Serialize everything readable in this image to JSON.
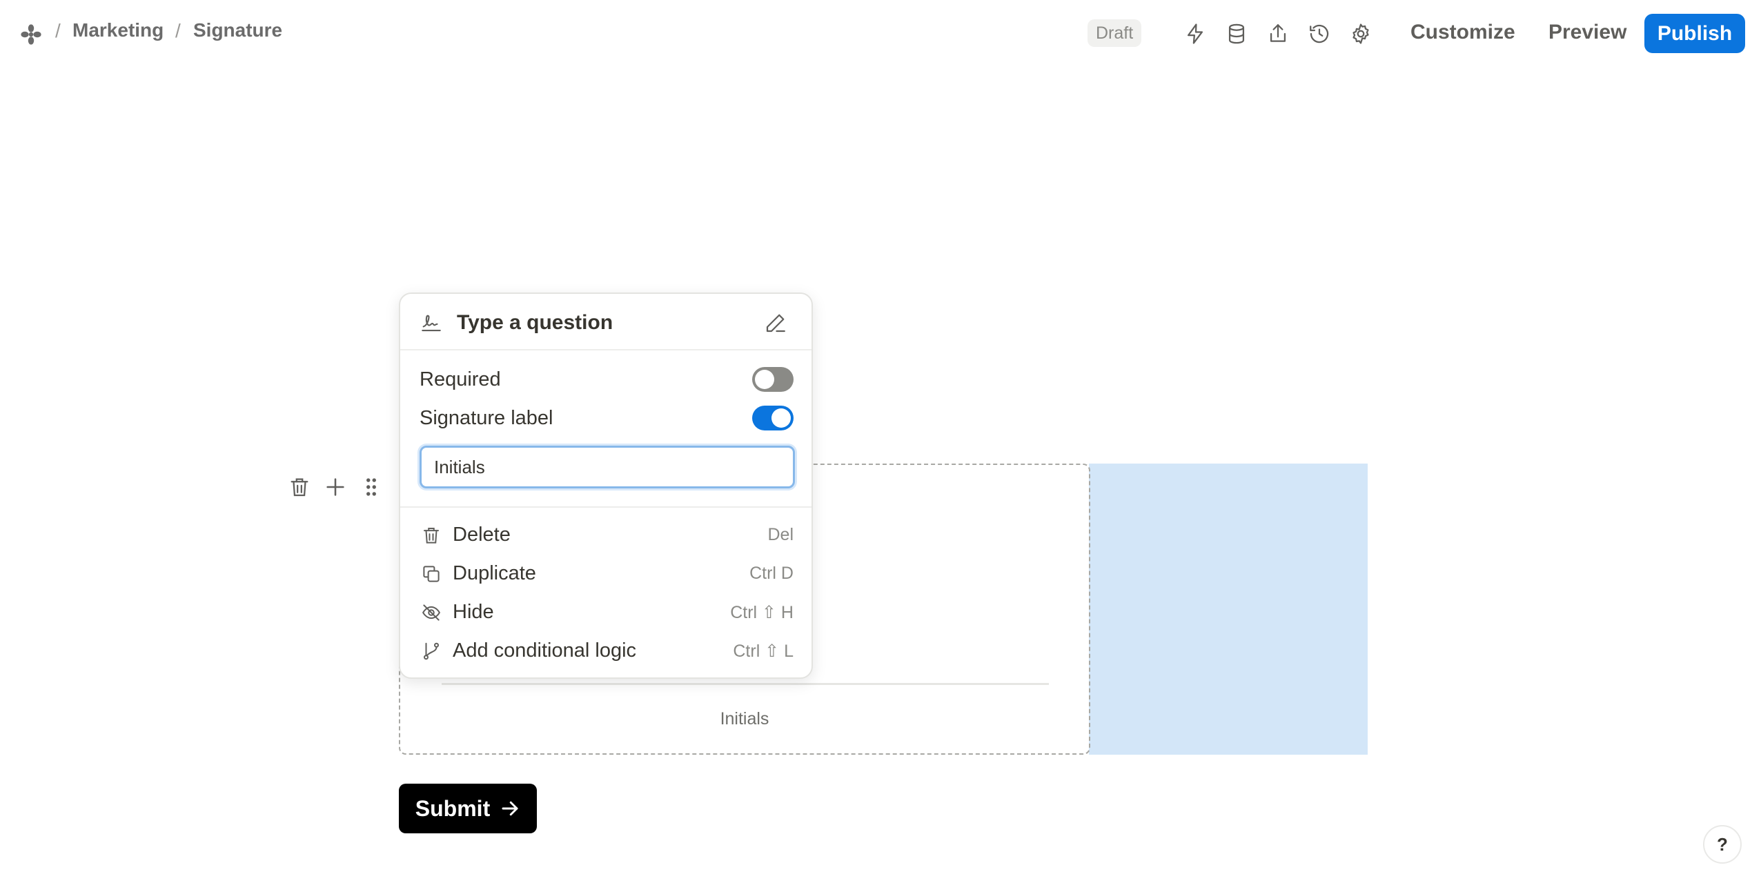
{
  "header": {
    "breadcrumb": [
      "Marketing",
      "Signature"
    ],
    "status_badge": "Draft",
    "icons": [
      "bolt-icon",
      "database-icon",
      "share-icon",
      "history-icon",
      "settings-icon"
    ],
    "customize_label": "Customize",
    "preview_label": "Preview",
    "publish_label": "Publish",
    "accent_color": "#0b75de"
  },
  "block": {
    "tools": [
      "trash-icon",
      "plus-icon",
      "drag-handle-icon"
    ],
    "signature_caption": "Initials",
    "highlight_color": "#d3e6f8"
  },
  "popup": {
    "question_placeholder": "Type a question",
    "required_label": "Required",
    "required_on": false,
    "signature_label_label": "Signature label",
    "signature_label_on": true,
    "signature_label_value": "Initials",
    "menu": [
      {
        "label": "Delete",
        "shortcut": "Del",
        "icon": "trash-icon"
      },
      {
        "label": "Duplicate",
        "shortcut": "Ctrl D",
        "icon": "duplicate-icon"
      },
      {
        "label": "Hide",
        "shortcut": "Ctrl ⇧ H",
        "icon": "eye-off-icon"
      },
      {
        "label": "Add conditional logic",
        "shortcut": "Ctrl ⇧ L",
        "icon": "branch-icon"
      }
    ]
  },
  "submit": {
    "label": "Submit"
  },
  "help": {
    "label": "?"
  }
}
